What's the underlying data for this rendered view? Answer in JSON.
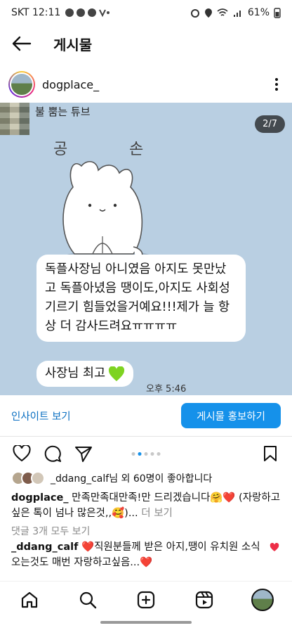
{
  "status_bar": {
    "time": "SKT 12:11",
    "battery": "61%"
  },
  "header": {
    "title": "게시물"
  },
  "author": {
    "username": "dogplace_"
  },
  "image": {
    "chat_name": "불 뿜는 튜브",
    "counter": "2/7",
    "sticker_text_left": "공",
    "sticker_text_right": "손",
    "bubble_1": "독플사장님 아니였음 아지도 못만났고 독플아녔음 땡이도,아지도 사회성 기르기 힘들었을거예요!!!제가 늘 항상 더 감사드려요ㅠㅠㅠㅠ",
    "bubble_2": "사장님 최고",
    "time": "오후 5:46"
  },
  "promo": {
    "insights_label": "인사이트 보기",
    "promote_label": "게시물 홍보하기"
  },
  "likes": {
    "text": "_ddang_calf님 외 60명이 좋아합니다"
  },
  "caption": {
    "username": "dogplace_",
    "text": " 만족만족대만족!만 드리겠습니다🤗❤️ (자랑하고싶은 톡이 넘나 많은것,,🥰)... ",
    "more_label": "더 보기"
  },
  "comments": {
    "view_all_label": "댓글 3개 모두 보기",
    "first": {
      "username": "_ddang_calf",
      "text": " ❤️직원분들께 받은 아지,땡이 유치원 소식오는것도 매번 자랑하고싶음...❤️"
    }
  },
  "colors": {
    "accent": "#1591ea",
    "image_bg": "#b9cfe2",
    "link": "#0a6fc2"
  },
  "nav": {
    "items": [
      "home-icon",
      "search-icon",
      "create-icon",
      "reels-icon",
      "profile-avatar"
    ]
  }
}
